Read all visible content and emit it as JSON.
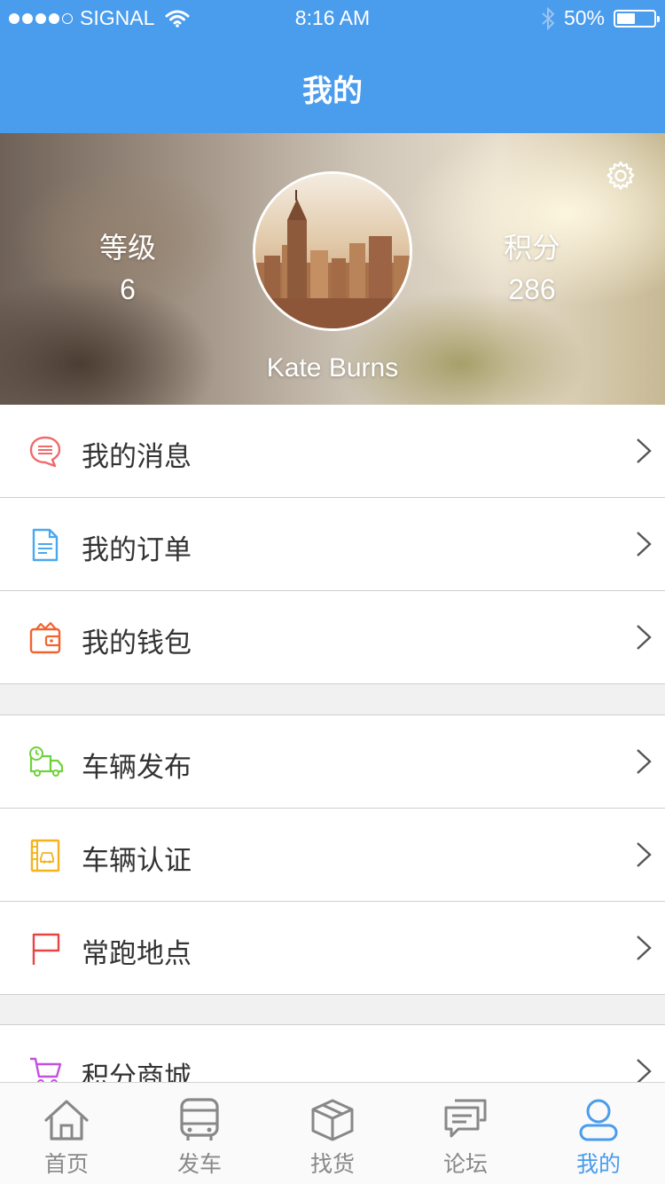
{
  "status_bar": {
    "carrier": "SIGNAL",
    "time": "8:16 AM",
    "battery_percent": "50%",
    "battery_level": 0.5,
    "signal_dots_filled": 4,
    "icons": [
      "signal-dots-icon",
      "wifi-icon",
      "bluetooth-icon",
      "battery-icon"
    ]
  },
  "nav": {
    "title": "我的"
  },
  "profile": {
    "level_label": "等级",
    "level_value": "6",
    "points_label": "积分",
    "points_value": "286",
    "username": "Kate Burns",
    "settings_icon": "gear-icon"
  },
  "menu_groups": [
    {
      "items": [
        {
          "label": "我的消息",
          "icon": "message-bubble-icon",
          "color": "#f06a6a"
        },
        {
          "label": "我的订单",
          "icon": "document-icon",
          "color": "#4aa8ee"
        },
        {
          "label": "我的钱包",
          "icon": "wallet-icon",
          "color": "#f06430"
        }
      ]
    },
    {
      "items": [
        {
          "label": "车辆发布",
          "icon": "truck-clock-icon",
          "color": "#6fd23a"
        },
        {
          "label": "车辆认证",
          "icon": "vehicle-certificate-icon",
          "color": "#f5b21b"
        },
        {
          "label": "常跑地点",
          "icon": "flag-icon",
          "color": "#e64545"
        }
      ]
    },
    {
      "items": [
        {
          "label": "积分商城",
          "icon": "shopping-cart-icon",
          "color": "#c450e0"
        }
      ]
    }
  ],
  "tabs": [
    {
      "label": "首页",
      "icon": "home-icon",
      "active": false
    },
    {
      "label": "发车",
      "icon": "bus-icon",
      "active": false
    },
    {
      "label": "找货",
      "icon": "package-box-icon",
      "active": false
    },
    {
      "label": "论坛",
      "icon": "forum-chat-icon",
      "active": false
    },
    {
      "label": "我的",
      "icon": "user-icon",
      "active": true
    }
  ],
  "colors": {
    "accent": "#4a9ced",
    "tab_inactive": "#888888",
    "separator": "#f1f1f1"
  }
}
